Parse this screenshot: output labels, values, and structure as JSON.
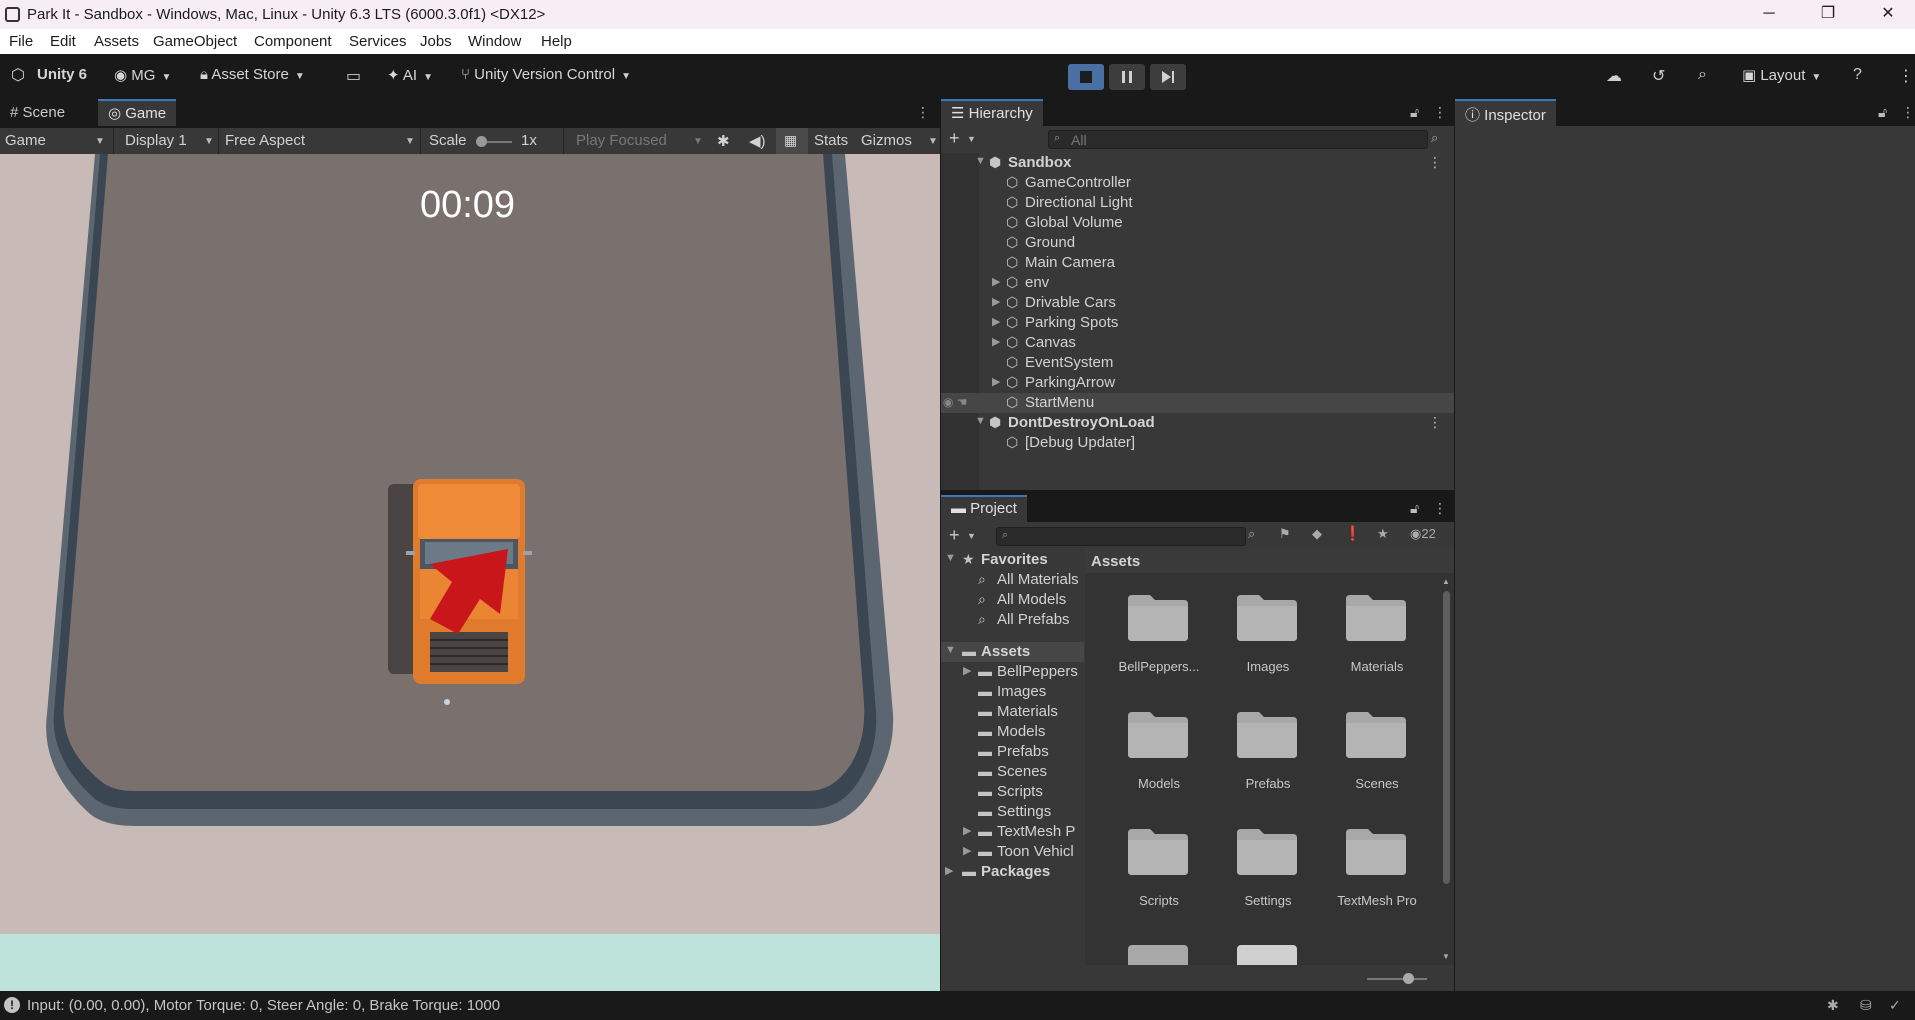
{
  "window": {
    "title": "Park It - Sandbox - Windows, Mac, Linux - Unity 6.3 LTS (6000.3.0f1) <DX12>",
    "minimize": "─",
    "restore": "❐",
    "close": "✕"
  },
  "menu": [
    "File",
    "Edit",
    "Assets",
    "GameObject",
    "Component",
    "Services",
    "Jobs",
    "Window",
    "Help"
  ],
  "toolbar": {
    "unity_label": "Unity 6",
    "account": "MG",
    "asset_store": "Asset Store",
    "ai": "AI",
    "version_control": "Unity Version Control",
    "layout": "Layout"
  },
  "scene_tabs": {
    "scene": "Scene",
    "game": "Game"
  },
  "game_toolbar": {
    "view": "Game",
    "display": "Display 1",
    "aspect": "Free Aspect",
    "scale_label": "Scale",
    "scale_value": "1x",
    "play_mode": "Play Focused",
    "stats": "Stats",
    "gizmos": "Gizmos"
  },
  "game": {
    "timer": "00:09"
  },
  "hierarchy": {
    "tab": "Hierarchy",
    "search_placeholder": "All",
    "rows": [
      {
        "label": "Sandbox",
        "depth": 0,
        "expanded": true,
        "scene": true
      },
      {
        "label": "GameController",
        "depth": 1
      },
      {
        "label": "Directional Light",
        "depth": 1
      },
      {
        "label": "Global Volume",
        "depth": 1
      },
      {
        "label": "Ground",
        "depth": 1
      },
      {
        "label": "Main Camera",
        "depth": 1
      },
      {
        "label": "env",
        "depth": 1,
        "collapsed": true
      },
      {
        "label": "Drivable Cars",
        "depth": 1,
        "collapsed": true
      },
      {
        "label": "Parking Spots",
        "depth": 1,
        "collapsed": true
      },
      {
        "label": "Canvas",
        "depth": 1,
        "collapsed": true
      },
      {
        "label": "EventSystem",
        "depth": 1
      },
      {
        "label": "ParkingArrow",
        "depth": 1,
        "collapsed": true
      },
      {
        "label": "StartMenu",
        "depth": 1,
        "selected": true
      },
      {
        "label": "DontDestroyOnLoad",
        "depth": 0,
        "expanded": true,
        "scene": true
      },
      {
        "label": "[Debug Updater]",
        "depth": 1
      }
    ]
  },
  "project": {
    "tab": "Project",
    "hidden_count": "22",
    "favorites": {
      "label": "Favorites",
      "items": [
        "All Materials",
        "All Models",
        "All Prefabs"
      ]
    },
    "assets": {
      "label": "Assets",
      "items": [
        {
          "label": "BellPeppers",
          "collapsed": true
        },
        {
          "label": "Images"
        },
        {
          "label": "Materials"
        },
        {
          "label": "Models"
        },
        {
          "label": "Prefabs"
        },
        {
          "label": "Scenes"
        },
        {
          "label": "Scripts"
        },
        {
          "label": "Settings"
        },
        {
          "label": "TextMesh P",
          "collapsed": true
        },
        {
          "label": "Toon Vehicl",
          "collapsed": true
        }
      ]
    },
    "packages": "Packages",
    "grid_header": "Assets",
    "grid": [
      "BellPeppers...",
      "Images",
      "Materials",
      "Models",
      "Prefabs",
      "Scenes",
      "Scripts",
      "Settings",
      "TextMesh Pro"
    ]
  },
  "inspector": {
    "tab": "Inspector"
  },
  "status": {
    "message": "Input: (0.00, 0.00), Motor Torque: 0, Steer Angle: 0, Brake Torque: 1000"
  }
}
